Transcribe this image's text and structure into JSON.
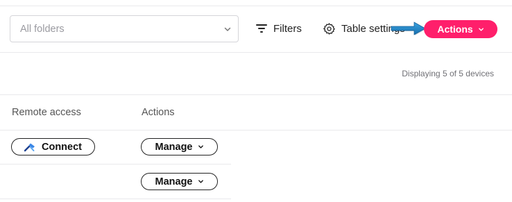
{
  "toolbar": {
    "folder_select": {
      "value": "All folders",
      "icon": "chevron-down-icon"
    },
    "filters": {
      "label": "Filters",
      "icon": "filter-lines-icon"
    },
    "table_settings": {
      "label": "Table settings",
      "icon": "gear-icon"
    },
    "actions": {
      "label": "Actions",
      "icon": "chevron-down-icon",
      "color": "#ff1f6b"
    },
    "annotation_arrow": {
      "icon": "arrow-right-icon",
      "color": "#1f86c8"
    }
  },
  "summary": {
    "text": "Displaying 5 of 5 devices"
  },
  "table": {
    "columns": [
      "Remote access",
      "Actions"
    ],
    "rows": [
      {
        "remote_access": {
          "label": "Connect",
          "icon": "remote-connect-icon"
        },
        "actions": {
          "label": "Manage",
          "icon": "chevron-down-icon"
        }
      },
      {
        "remote_access": null,
        "actions": {
          "label": "Manage",
          "icon": "chevron-down-icon"
        }
      }
    ]
  }
}
